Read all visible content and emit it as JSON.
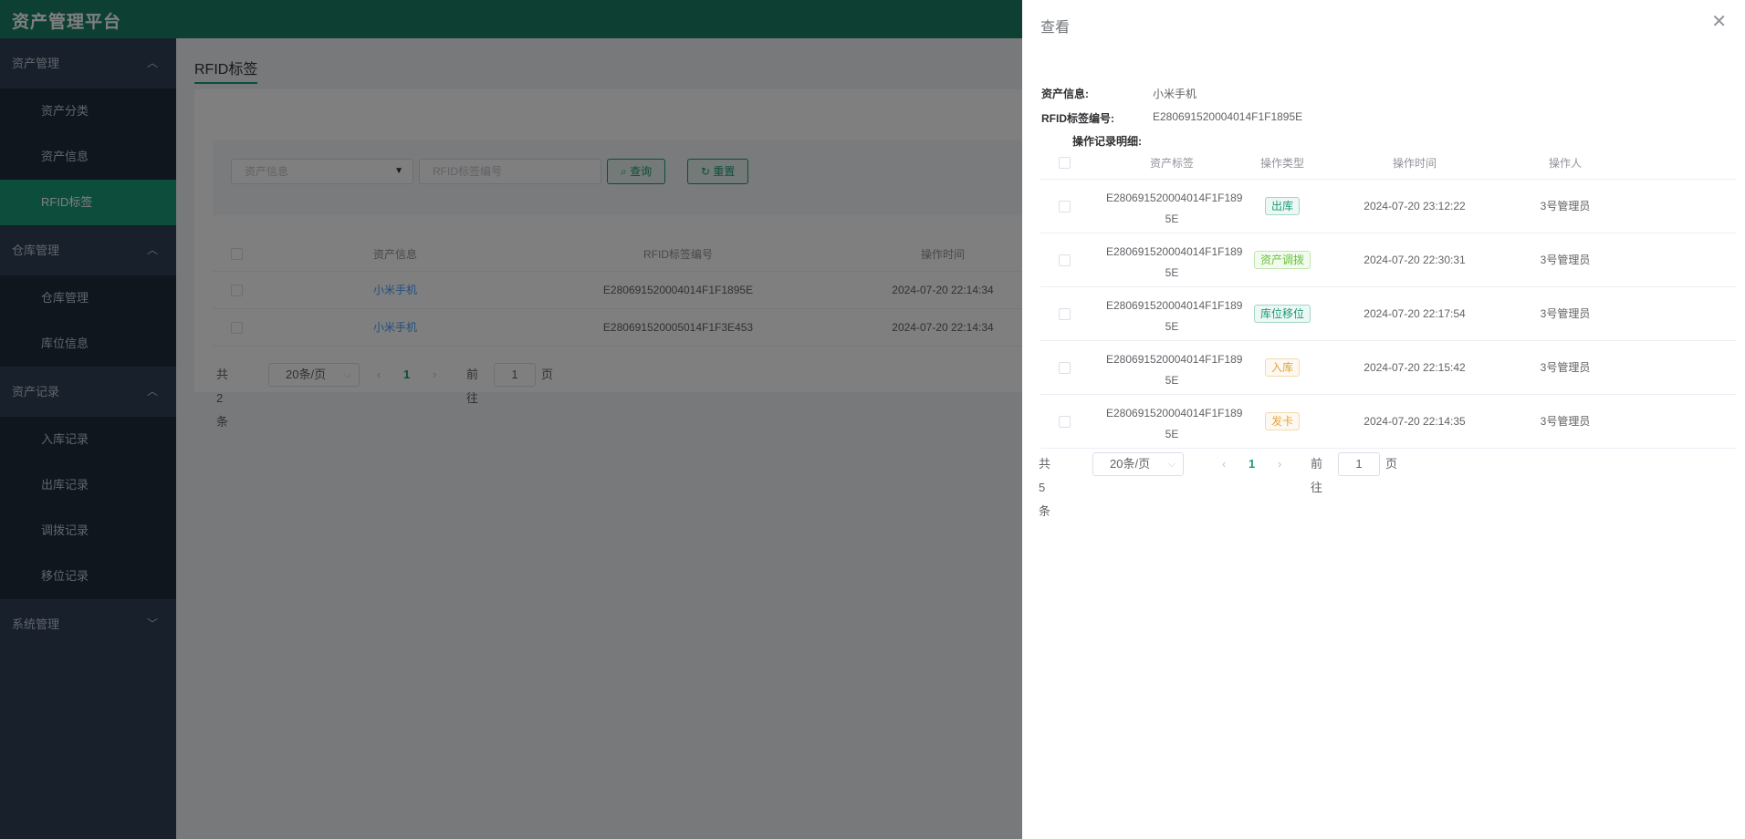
{
  "app": {
    "title": "资产管理平台"
  },
  "sidebar": {
    "groups": [
      {
        "label": "资产管理",
        "items": [
          "资产分类",
          "资产信息",
          "RFID标签"
        ]
      },
      {
        "label": "仓库管理",
        "items": [
          "仓库管理",
          "库位信息"
        ]
      },
      {
        "label": "资产记录",
        "items": [
          "入库记录",
          "出库记录",
          "调拨记录",
          "移位记录"
        ]
      },
      {
        "label": "系统管理"
      }
    ],
    "active_item": "RFID标签"
  },
  "main": {
    "tab_label": "RFID标签",
    "search": {
      "asset_placeholder": "资产信息",
      "rfid_placeholder": "RFID标签编号",
      "query_label": "查询",
      "reset_label": "重置"
    },
    "table": {
      "columns": [
        "资产信息",
        "RFID标签编号",
        "操作时间"
      ],
      "rows": [
        {
          "asset": "小米手机",
          "rfid": "E280691520004014F1F1895E",
          "time": "2024-07-20 22:14:34"
        },
        {
          "asset": "小米手机",
          "rfid": "E280691520005014F1F3E453",
          "time": "2024-07-20 22:14:34"
        }
      ]
    },
    "pager": {
      "total": "共 2 条",
      "size": "20条/页",
      "page": "1",
      "goto": "前往",
      "input": "1",
      "unit": "页"
    }
  },
  "drawer": {
    "title": "查看",
    "asset_label": "资产信息:",
    "asset_value": "小米手机",
    "rfid_label": "RFID标签编号:",
    "rfid_value": "E280691520004014F1F1895E",
    "records_label": "操作记录明细:",
    "columns": [
      "资产标签",
      "操作类型",
      "操作时间",
      "操作人"
    ],
    "rows": [
      {
        "tag_line1": "E280691520004014F1F189",
        "tag_line2": "5E",
        "type": "出库",
        "color": "#1b9a78",
        "time": "2024-07-20 23:12:22",
        "operator": "3号管理员"
      },
      {
        "tag_line1": "E280691520004014F1F189",
        "tag_line2": "5E",
        "type": "资产调拨",
        "color": "#67c23a",
        "time": "2024-07-20 22:30:31",
        "operator": "3号管理员"
      },
      {
        "tag_line1": "E280691520004014F1F189",
        "tag_line2": "5E",
        "type": "库位移位",
        "color": "#1b9a78",
        "time": "2024-07-20 22:17:54",
        "operator": "3号管理员"
      },
      {
        "tag_line1": "E280691520004014F1F189",
        "tag_line2": "5E",
        "type": "入库",
        "color": "#e6a23c",
        "time": "2024-07-20 22:15:42",
        "operator": "3号管理员"
      },
      {
        "tag_line1": "E280691520004014F1F189",
        "tag_line2": "5E",
        "type": "发卡",
        "color": "#e6a23c",
        "time": "2024-07-20 22:14:35",
        "operator": "3号管理员"
      }
    ],
    "pager": {
      "total": "共 5 条",
      "size": "20条/页",
      "page": "1",
      "goto": "前往",
      "input": "1",
      "unit": "页"
    }
  },
  "icons": {
    "chevron_up": "chevron-up-icon",
    "chevron_down": "chevron-down-icon",
    "close": "close-icon",
    "search": "search-icon",
    "refresh": "refresh-icon"
  }
}
